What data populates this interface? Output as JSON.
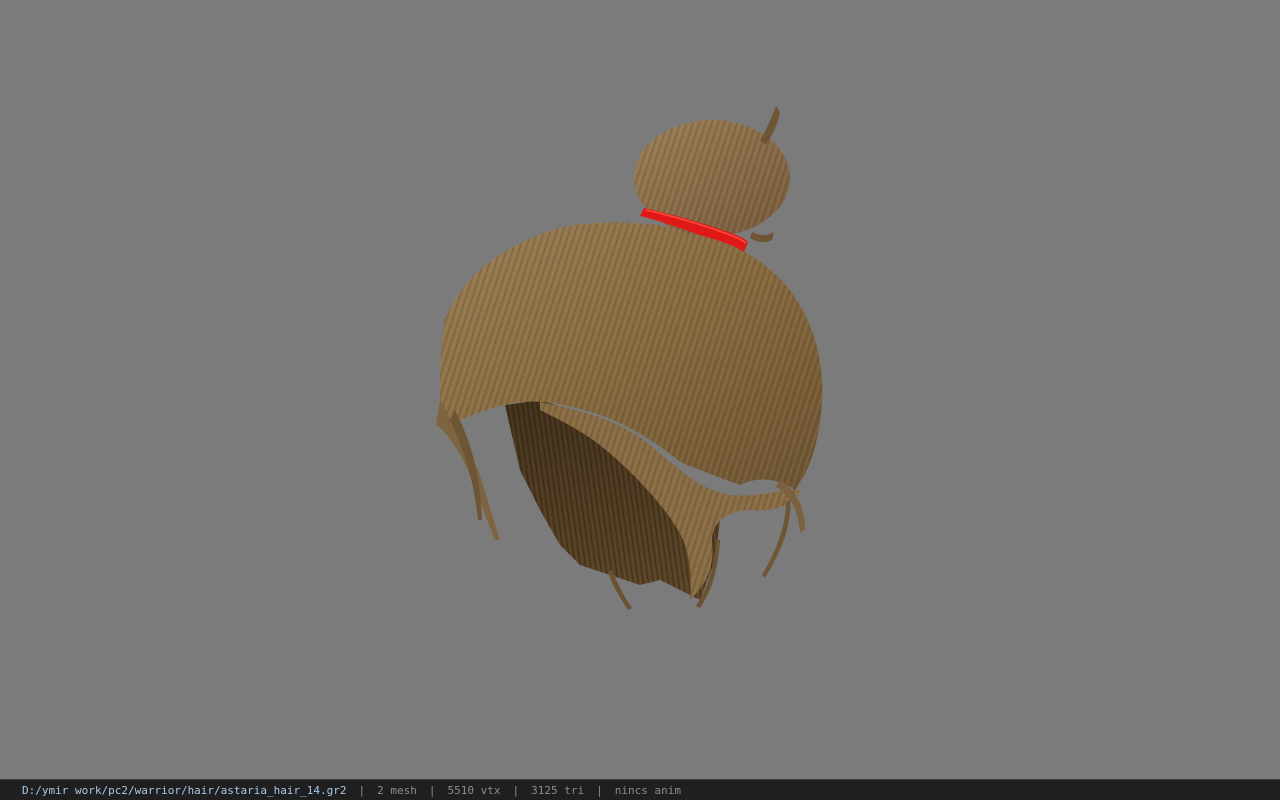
{
  "viewer": {
    "background_color": "#7b7b7b",
    "model": {
      "name": "hair-bun-model",
      "hair_color": "#8a6e48",
      "hair_shadow_color": "#4a3820",
      "band_color": "#e01818"
    }
  },
  "status": {
    "file_path": "D:/ymir work/pc2/warrior/hair/astaria_hair_14.gr2",
    "separator": "|",
    "mesh": "2 mesh",
    "vtx": "5510 vtx",
    "tri": "3125 tri",
    "anim": "nincs anim"
  }
}
